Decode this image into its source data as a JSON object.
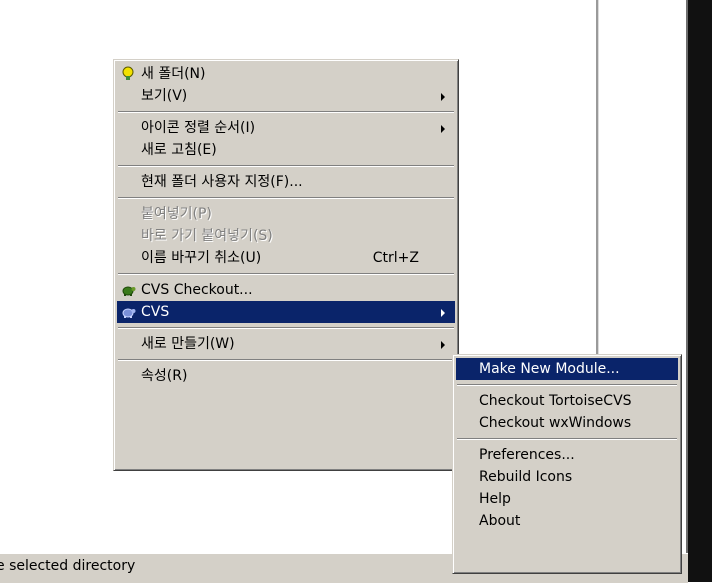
{
  "status_bar": {
    "text": "e selected directory"
  },
  "context_menu": {
    "items": [
      {
        "label": "새 폴더(N)",
        "icon": "new-folder-bulb-icon"
      },
      {
        "label": "보기(V)",
        "submenu": true
      },
      {
        "label": "아이콘 정렬 순서(I)",
        "submenu": true
      },
      {
        "label": "새로 고침(E)"
      },
      {
        "label": "현재 폴더 사용자 지정(F)..."
      },
      {
        "label": "붙여넣기(P)",
        "disabled": true
      },
      {
        "label": "바로 가기 붙여넣기(S)",
        "disabled": true
      },
      {
        "label": "이름 바꾸기 취소(U)",
        "shortcut": "Ctrl+Z"
      },
      {
        "label": "CVS Checkout...",
        "icon": "tortoise-icon"
      },
      {
        "label": "CVS",
        "icon": "tortoise-icon",
        "submenu": true,
        "selected": true
      },
      {
        "label": "새로 만들기(W)",
        "submenu": true
      },
      {
        "label": "속성(R)"
      }
    ]
  },
  "cvs_submenu": {
    "items": [
      {
        "label": "Make New Module...",
        "selected": true
      },
      {
        "label": "Checkout TortoiseCVS"
      },
      {
        "label": "Checkout wxWindows"
      },
      {
        "label": "Preferences..."
      },
      {
        "label": "Rebuild Icons"
      },
      {
        "label": "Help"
      },
      {
        "label": "About"
      }
    ]
  },
  "colors": {
    "menu_bg": "#d4d0c8",
    "highlight": "#0a246a",
    "disabled_text": "#808080"
  }
}
